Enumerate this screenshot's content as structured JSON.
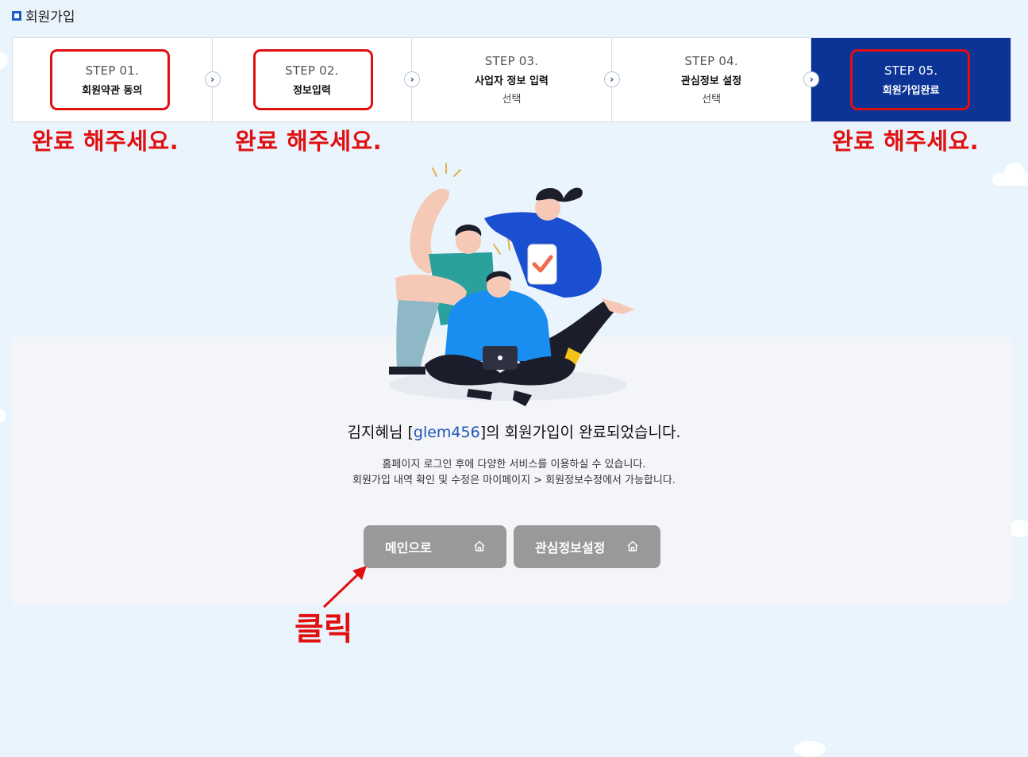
{
  "header": {
    "title": "회원가입"
  },
  "steps": [
    {
      "no": "STEP 01.",
      "name": "회원약관 동의",
      "sub": ""
    },
    {
      "no": "STEP 02.",
      "name": "정보입력",
      "sub": ""
    },
    {
      "no": "STEP 03.",
      "name": "사업자 정보 입력",
      "sub": "선택"
    },
    {
      "no": "STEP 04.",
      "name": "관심정보 설정",
      "sub": "선택"
    },
    {
      "no": "STEP 05.",
      "name": "회원가입완료",
      "sub": ""
    }
  ],
  "annotations": {
    "complete_note": "완료 해주세요.",
    "click_note": "클릭"
  },
  "result": {
    "name_prefix": "김지혜님 [",
    "user_id": "glem456",
    "name_suffix": "]의 회원가입이 완료되었습니다.",
    "desc_line1": "홈페이지 로그인 후에 다양한 서비스를 이용하실 수 있습니다.",
    "desc_line2": "회원가입 내역 확인 및 수정은 마이페이지 > 회원정보수정에서 가능합니다."
  },
  "buttons": {
    "main_label": "메인으로",
    "interest_label": "관심정보설정"
  },
  "colors": {
    "background": "#eaf4fd",
    "active_step": "#0c3496",
    "annotation_red": "#e01010",
    "button_gray": "#999999",
    "user_id_blue": "#1e56b4"
  }
}
